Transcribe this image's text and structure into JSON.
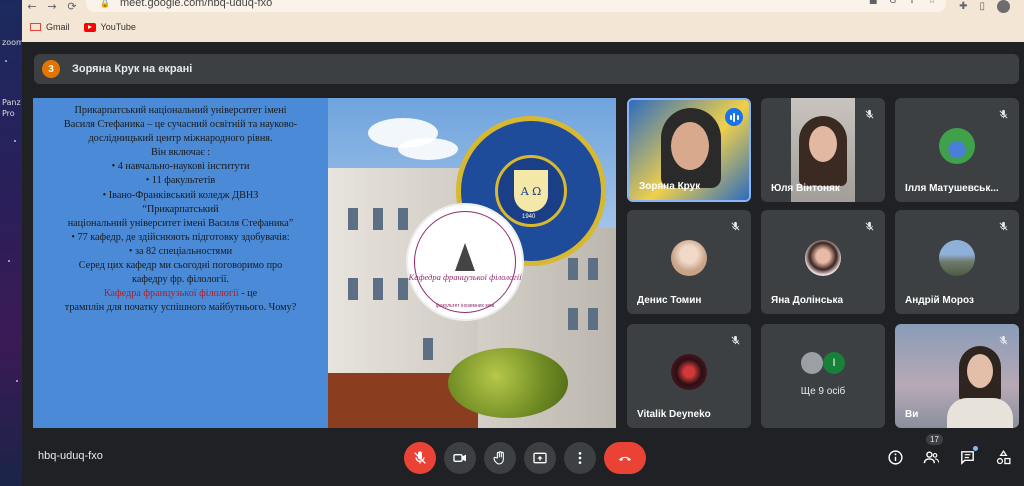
{
  "browser": {
    "url": "meet.google.com/hbq-uduq-fxo",
    "bookmarks": [
      {
        "label": "Gmail",
        "icon": "gmail-icon"
      },
      {
        "label": "YouTube",
        "icon": "youtube-icon"
      }
    ]
  },
  "desktop": {
    "icons": [
      {
        "label": "zoom"
      },
      {
        "label": "Panz"
      },
      {
        "label": "Pro"
      }
    ]
  },
  "presenting_banner": {
    "count": "3",
    "text": "Зоряна Крук на екрані"
  },
  "slide": {
    "lines": [
      "Прикарпатський національний університет імені",
      "Василя Стефаника – це сучасний  освітній та науково-",
      "дослідницький центр міжнародного рівня.",
      "Він включає :",
      "• 4 навчально-наукові інститути",
      "• 11 факультетів",
      "• Івано-Франківський коледж ДВНЗ",
      "“Прикарпатський",
      "національний університет імені Василя Стефаника”",
      "• 77 кафедр, де здійснюють підготовку здобувачів:",
      "• за 82 спеціальностями",
      "Серед цих кафедр ми сьогодні поговоримо про",
      "кафедру фр. філології."
    ],
    "highlight": "Кафедра французької філології",
    "highlight_suffix": " - це",
    "last_line": "трамплін для початку успішного майбутнього. Чому?",
    "seal_letters": "A Ω",
    "seal_year": "1940",
    "stamp_title": "Кафедра французької філології",
    "stamp_ring": "факультет іноземних мов"
  },
  "participants": [
    {
      "name": "Зоряна Крук",
      "speaking": true
    },
    {
      "name": "Юля Вінтоняк",
      "muted": true
    },
    {
      "name": "Ілля Матушевськ...",
      "muted": true
    },
    {
      "name": "Денис Томин",
      "muted": true
    },
    {
      "name": "Яна Долінська",
      "muted": true
    },
    {
      "name": "Андрій Мороз",
      "muted": true
    },
    {
      "name": "Vitalik Deyneko",
      "muted": true
    },
    {
      "name": "Ще 9 осіб",
      "initial": "I"
    },
    {
      "name": "Ви",
      "muted": true
    }
  ],
  "controls": {
    "meeting_code": "hbq-uduq-fxo",
    "people_count": "17"
  },
  "colors": {
    "meet_bg": "#202124",
    "tile_bg": "#3c4043",
    "end_call": "#ea4335",
    "presenter_badge": "#e37400"
  }
}
